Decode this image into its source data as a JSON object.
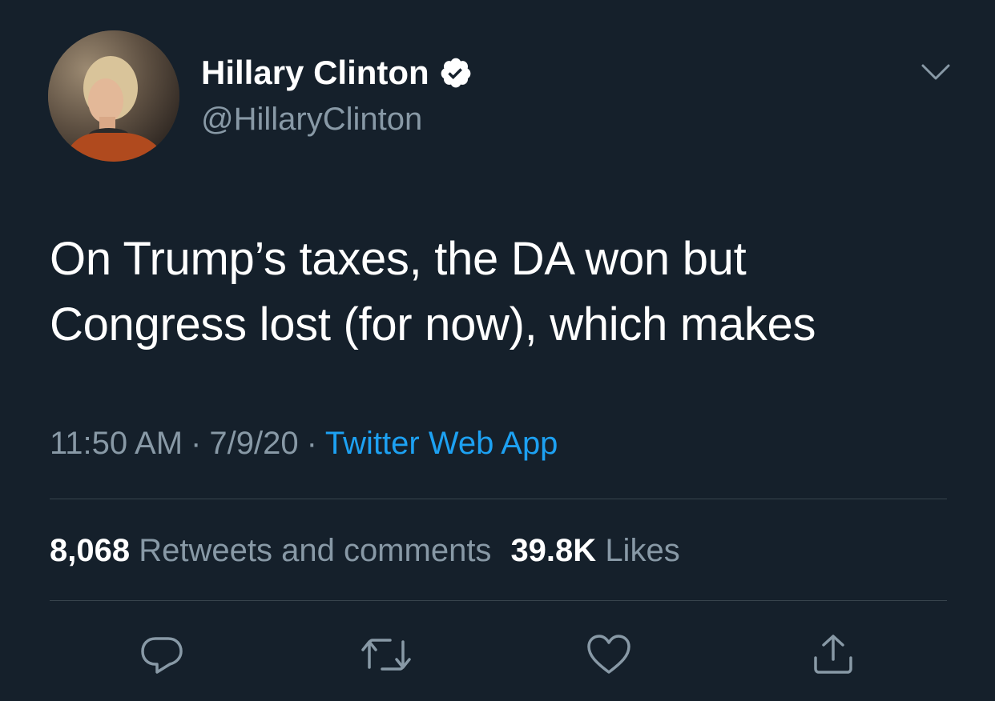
{
  "user": {
    "display_name": "Hillary Clinton",
    "handle": "@HillaryClinton",
    "verified": true
  },
  "tweet": {
    "text": "On Trump’s taxes, the DA won but\nCongress lost (for now), which makes",
    "time": "11:50 AM",
    "date": "7/9/20",
    "separator": "·",
    "source": "Twitter Web App"
  },
  "stats": {
    "retweets_count": "8,068",
    "retweets_label": "Retweets and comments",
    "likes_count": "39.8K",
    "likes_label": "Likes"
  },
  "icons": {
    "reply": "reply-icon",
    "retweet": "retweet-icon",
    "like": "heart-icon",
    "share": "share-icon",
    "more": "chevron-down-icon",
    "verified": "verified-badge-icon"
  },
  "colors": {
    "background": "#15202b",
    "text": "#ffffff",
    "secondary": "#8899a6",
    "accent": "#1da1f2",
    "divider": "#38444d"
  }
}
